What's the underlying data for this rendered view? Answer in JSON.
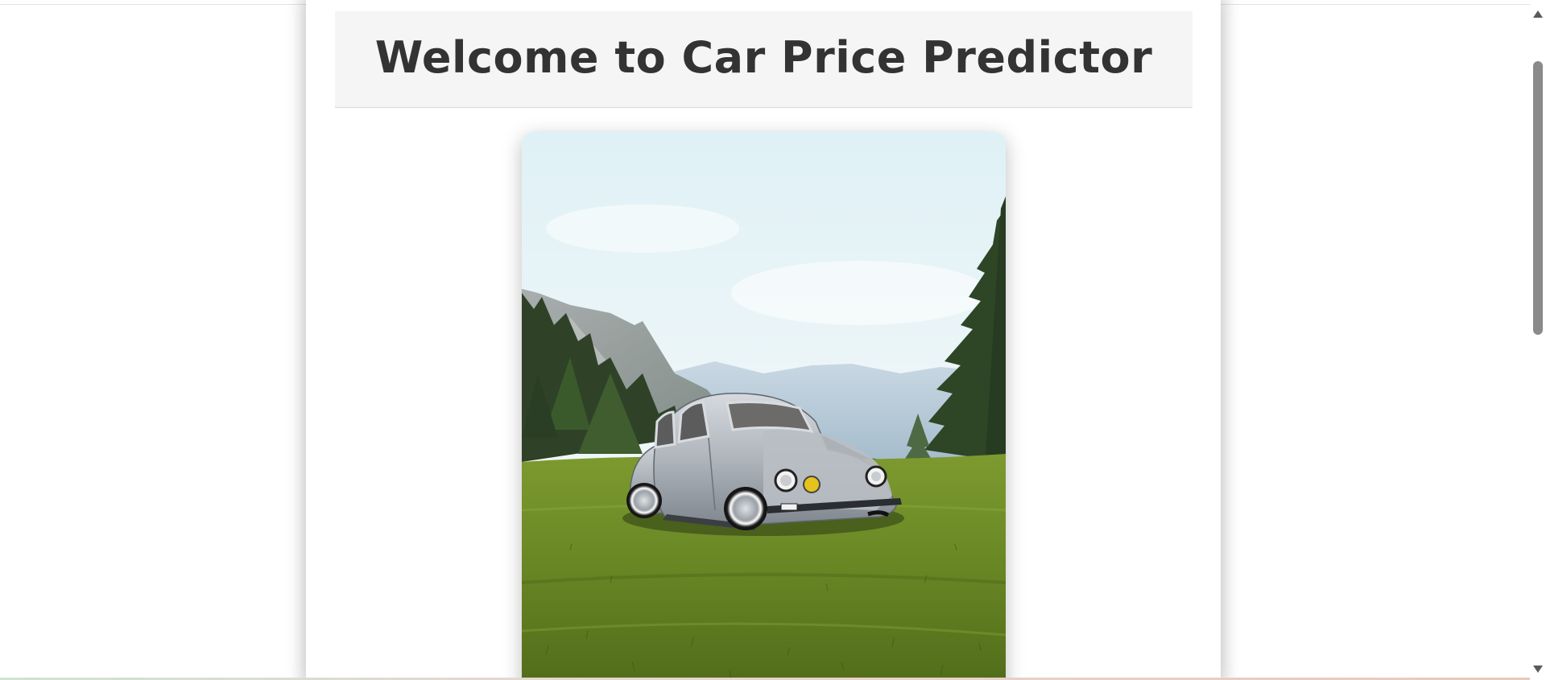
{
  "page": {
    "title": "Welcome to Car Price Predictor"
  },
  "hero": {
    "image_subject": "silver-beetle-car-on-grass-with-mountains"
  },
  "colors": {
    "title_text": "#333333",
    "header_bg": "#f5f5f5",
    "page_bg": "#ffffff",
    "scroll_thumb": "#8a8a8a"
  },
  "icons": {
    "scroll_up": "triangle-up",
    "scroll_down": "triangle-down"
  }
}
